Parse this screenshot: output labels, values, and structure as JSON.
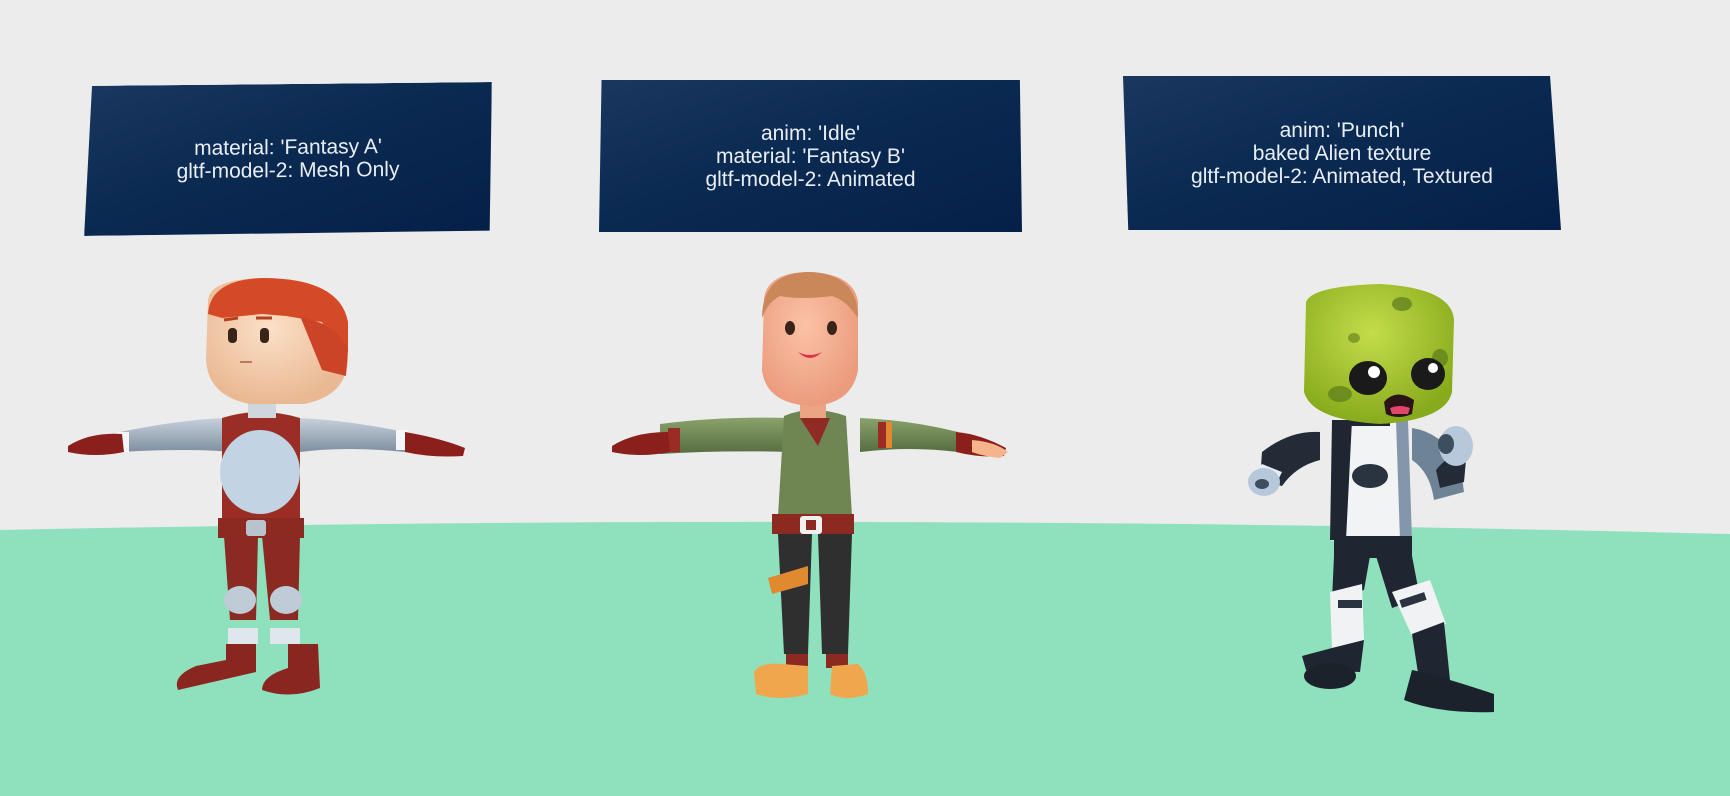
{
  "scene": {
    "background_color": "#ececec",
    "ground_color": "#8fe0bd"
  },
  "signs": [
    {
      "lines": [
        "material: 'Fantasy A'",
        "gltf-model-2: Mesh Only"
      ]
    },
    {
      "lines": [
        "anim: 'Idle'",
        "material: 'Fantasy B'",
        "gltf-model-2: Animated"
      ]
    },
    {
      "lines": [
        "anim: 'Punch'",
        "baked Alien texture",
        "gltf-model-2: Animated, Textured"
      ]
    }
  ],
  "characters": [
    {
      "name": "red-haired-character",
      "pose": "T-pose"
    },
    {
      "name": "brown-haired-character",
      "pose": "T-pose"
    },
    {
      "name": "alien-character",
      "pose": "punch"
    }
  ]
}
